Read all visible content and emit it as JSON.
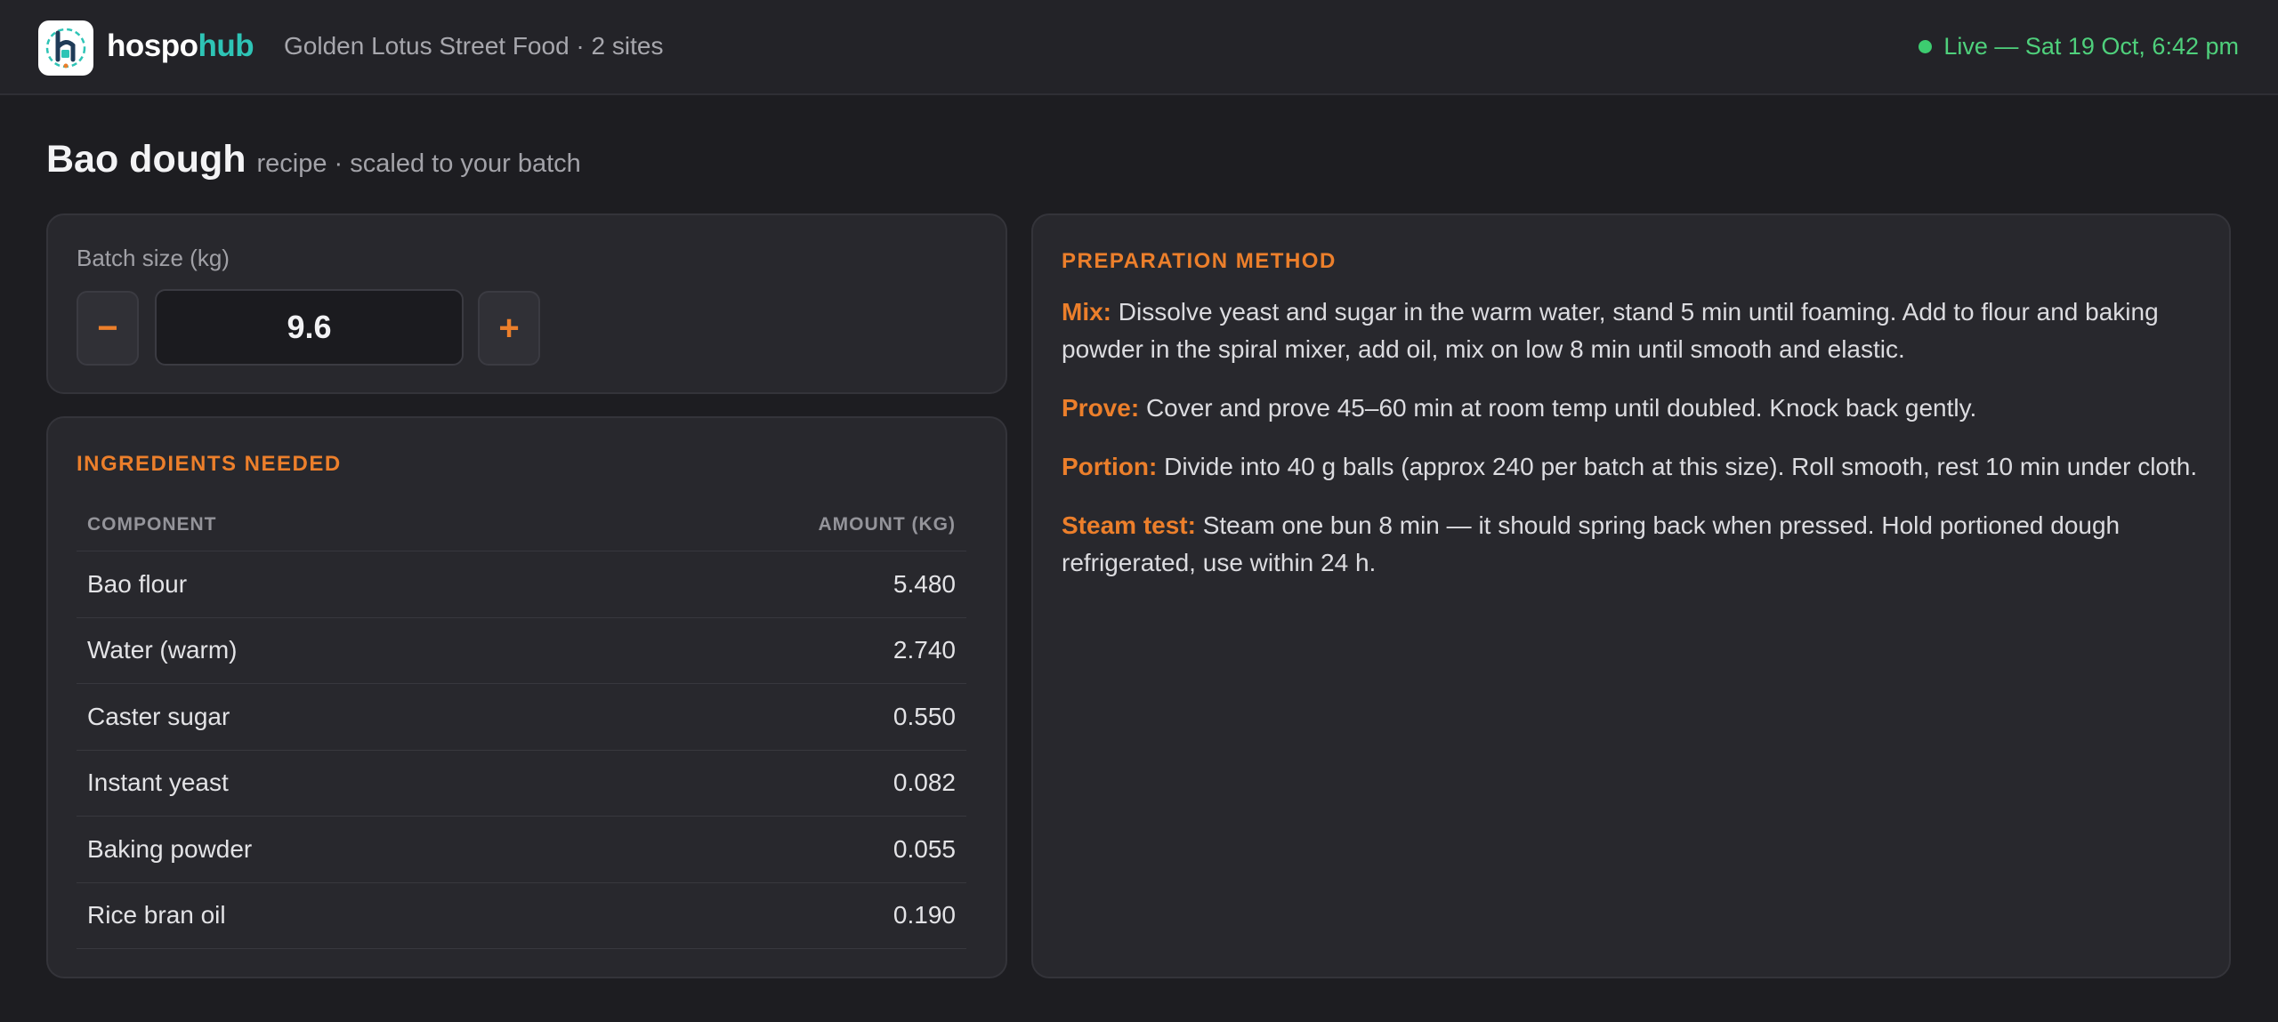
{
  "app": {
    "brand_part1": "hospo",
    "brand_part2": "hub",
    "organisation": "Golden Lotus Street Food · 2 sites",
    "live_status": "Live — Sat 19 Oct, 6:42 pm"
  },
  "page": {
    "title": "Bao dough",
    "subtitle": "recipe · scaled to your batch"
  },
  "batch": {
    "label": "Batch size (kg)",
    "value": "9.6",
    "decrement_label": "−",
    "increment_label": "+"
  },
  "ingredients": {
    "section_title": "INGREDIENTS NEEDED",
    "columns": [
      "COMPONENT",
      "AMOUNT (KG)"
    ],
    "rows": [
      {
        "name": "Bao flour",
        "amount": "5.480"
      },
      {
        "name": "Water (warm)",
        "amount": "2.740"
      },
      {
        "name": "Caster sugar",
        "amount": "0.550"
      },
      {
        "name": "Instant yeast",
        "amount": "0.082"
      },
      {
        "name": "Baking powder",
        "amount": "0.055"
      },
      {
        "name": "Rice bran oil",
        "amount": "0.190"
      }
    ]
  },
  "method": {
    "section_title": "PREPARATION METHOD",
    "steps": [
      {
        "label": "Mix:",
        "text": "Dissolve yeast and sugar in the warm water, stand 5 min until foaming. Add to flour and baking powder in the spiral mixer, add oil, mix on low 8 min until smooth and elastic."
      },
      {
        "label": "Prove:",
        "text": "Cover and prove 45–60 min at room temp until doubled. Knock back gently."
      },
      {
        "label": "Portion:",
        "text": "Divide into 40 g balls (approx 240 per batch at this size). Roll smooth, rest 10 min under cloth."
      },
      {
        "label": "Steam test:",
        "text": "Steam one bun 8 min — it should spring back when pressed. Hold portioned dough refrigerated, use within 24 h."
      }
    ]
  },
  "colors": {
    "accent": "#ec7f2b",
    "brand_teal": "#2ec4b6",
    "live_green": "#4fd07c",
    "background": "#1d1d21",
    "panel": "#28282d"
  },
  "icons": {
    "logo": "hospohub-logo-icon",
    "status": "live-dot-icon"
  }
}
